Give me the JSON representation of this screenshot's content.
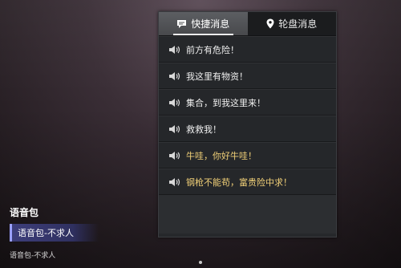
{
  "tabs": [
    {
      "label": "快捷消息",
      "icon": "chat-bubble-icon",
      "active": true
    },
    {
      "label": "轮盘消息",
      "icon": "map-pin-icon",
      "active": false
    }
  ],
  "messages": [
    {
      "text": "前方有危险！",
      "icon": "speaker-icon"
    },
    {
      "text": "我这里有物资！",
      "icon": "speaker-icon"
    },
    {
      "text": "集合，到我这里来！",
      "icon": "speaker-icon"
    },
    {
      "text": "救救我！",
      "icon": "speaker-icon"
    },
    {
      "text": "牛哇，你好牛哇！",
      "icon": "speaker-icon",
      "color": "#f2d178"
    },
    {
      "text": "钢枪不能苟，富贵险中求！",
      "icon": "speaker-icon",
      "color": "#f2d178"
    }
  ],
  "voice_pack": {
    "title": "语音包",
    "selected": "语音包-不求人",
    "subtitle": "语音包-不求人"
  },
  "colors": {
    "accent": "#9aa0ff",
    "highlight_text": "#f2d178",
    "panel_bg": "#26282b"
  }
}
